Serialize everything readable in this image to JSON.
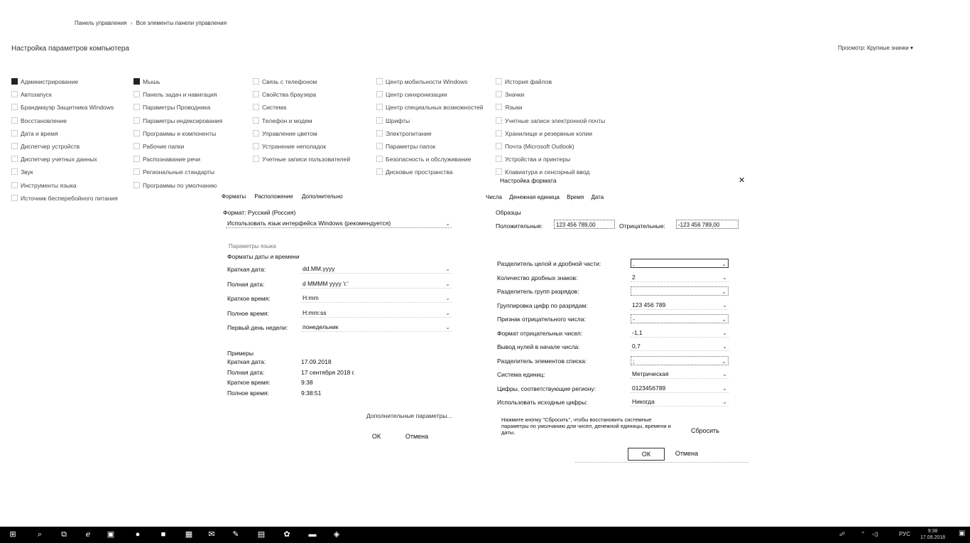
{
  "window": {
    "breadcrumb_links": [
      "Панель управления",
      "Все элементы панели управления"
    ],
    "breadcrumb_sep": "›",
    "heading": "Настройка параметров компьютера",
    "view_by": "Просмотр:  Крупные значки ▾"
  },
  "control_panel": {
    "columns": [
      [
        "Администрирование",
        "Автозапуск",
        "Брандмауэр Защитника Windows",
        "Восстановление",
        "Дата и время",
        "Диспетчер устройств",
        "Диспетчер учетных данных",
        "Звук",
        "Инструменты языка",
        "Источник бесперебойного питания"
      ],
      [
        "Мышь",
        "Панель задач и навигация",
        "Параметры Проводника",
        "Параметры индексирования",
        "Программы и компоненты",
        "Рабочие папки",
        "Распознавание речи",
        "Региональные стандарты",
        "Программы по умолчанию"
      ],
      [
        "Связь с телефоном",
        "Свойства браузера",
        "Система",
        "Телефон и модем",
        "Управление цветом",
        "Устранение неполадок",
        "Учетные записи пользователей"
      ],
      [
        "Центр мобильности Windows",
        "Центр синхронизации",
        "Центр специальных возможностей",
        "Шрифты",
        "Электропитание",
        "Параметры папок",
        "Безопасность и обслуживание",
        "Дисковые пространства"
      ],
      [
        "История файлов",
        "Значки",
        "Языки",
        "Учетные записи электронной почты",
        "Хранилище и резервные копии",
        "Почта (Microsoft Outlook)",
        "Устройства и принтеры",
        "Клавиатура и сенсорный ввод"
      ]
    ]
  },
  "region_dialog": {
    "tabs": [
      "Форматы",
      "Расположение",
      "Дополнительно"
    ],
    "format_label": "Формат: Русский (Россия)",
    "format_value": "Использовать язык интерфейса Windows (рекомендуется)",
    "language_pref_link": "Параметры языка",
    "section_title": "Форматы даты и времени",
    "rows": [
      {
        "label": "Краткая дата:",
        "value": "dd.MM.yyyy"
      },
      {
        "label": "Полная дата:",
        "value": "d MMMM yyyy 'г.'"
      },
      {
        "label": "Краткое время:",
        "value": "H:mm"
      },
      {
        "label": "Полное время:",
        "value": "H:mm:ss"
      },
      {
        "label": "Первый день недели:",
        "value": "понедельник"
      }
    ],
    "examples_title": "Примеры",
    "examples": [
      {
        "label": "Краткая дата:",
        "value": "17.09.2018"
      },
      {
        "label": "Полная дата:",
        "value": "17 сентября 2018 г."
      },
      {
        "label": "Краткое время:",
        "value": "9:38"
      },
      {
        "label": "Полное время:",
        "value": "9:38:51"
      }
    ],
    "extra_link": "Дополнительные параметры...",
    "ok": "ОК",
    "cancel": "Отмена"
  },
  "format_dialog": {
    "title": "Настройка формата",
    "close": "✕",
    "tabs": [
      "Числа",
      "Денежная единица",
      "Время",
      "Дата"
    ],
    "samples_title": "Образцы",
    "positive_label": "Положительные:",
    "positive_value": "123 456 789,00",
    "negative_label": "Отрицательные:",
    "negative_value": "-123 456 789,00",
    "rows": [
      {
        "label": "Разделитель целой и дробной части:",
        "value": ","
      },
      {
        "label": "Количество дробных знаков:",
        "value": "2"
      },
      {
        "label": "Разделитель групп разрядов:",
        "value": ""
      },
      {
        "label": "Группировка цифр по разрядам:",
        "value": "123 456 789"
      },
      {
        "label": "Признак отрицательного числа:",
        "value": "-"
      },
      {
        "label": "Формат отрицательных чисел:",
        "value": "-1,1"
      },
      {
        "label": "Вывод нулей в начале числа:",
        "value": "0,7"
      },
      {
        "label": "Разделитель элементов списка:",
        "value": ";"
      },
      {
        "label": "Система единиц:",
        "value": "Метрическая"
      },
      {
        "label": "Цифры, соответствующие региону:",
        "value": "0123456789"
      },
      {
        "label": "Использовать исходные цифры:",
        "value": "Никогда"
      }
    ],
    "reset_note": "Нажмите кнопку \"Сбросить\", чтобы восстановить системные параметры по умолчанию для чисел, денежной единицы, времени и даты.",
    "reset": "Сбросить",
    "ok": "ОК",
    "cancel": "Отмена"
  },
  "taskbar": {
    "icons": [
      "windows-icon",
      "search-icon",
      "task-view-icon",
      "edge-icon",
      "store-icon",
      "app-icon",
      "explorer-icon",
      "calculator-icon",
      "mail-icon",
      "paint-icon",
      "media-icon",
      "settings-icon",
      "folder-icon",
      "network-icon"
    ],
    "tray": {
      "lang": "РУС",
      "time": "9:38",
      "date": "17.09.2018"
    }
  }
}
